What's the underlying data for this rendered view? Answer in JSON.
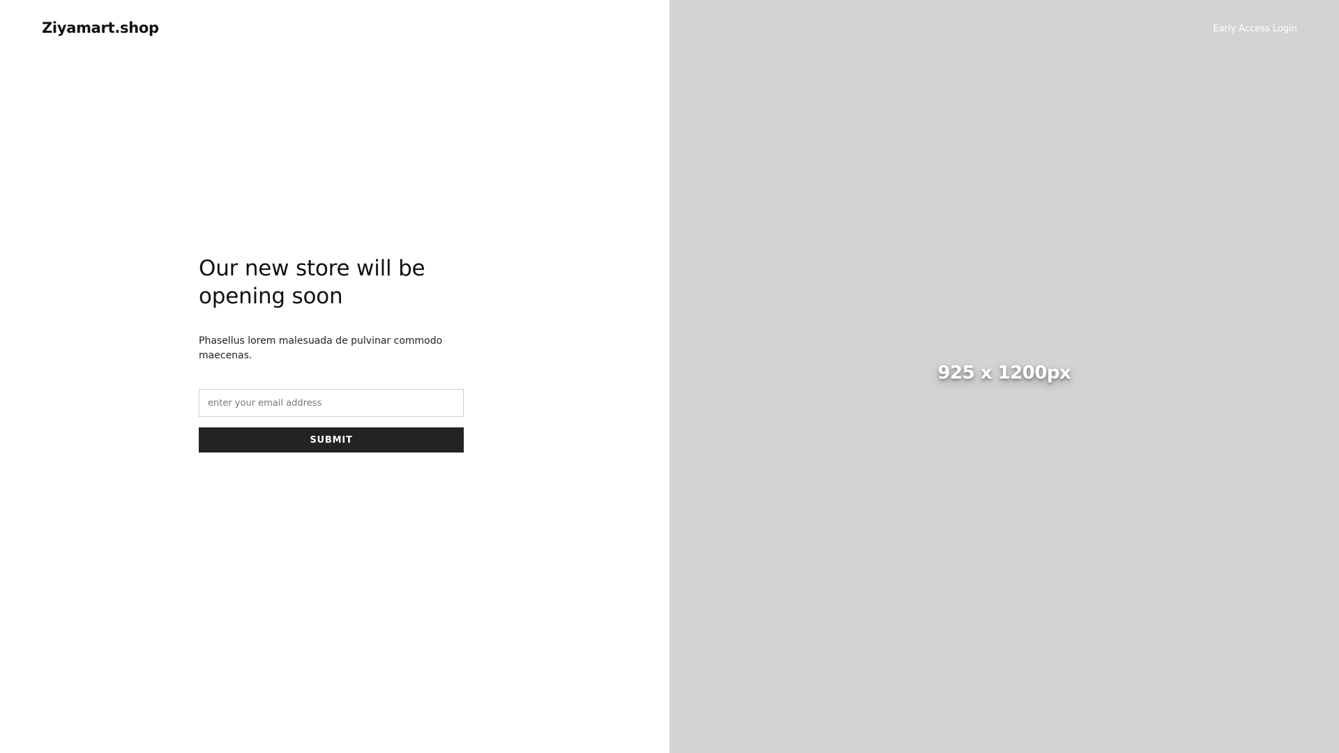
{
  "header": {
    "logo_text": "Ziyamart.shop",
    "early_access_label": "Early Access Login"
  },
  "main": {
    "headline_line1": "Our new store will be",
    "headline_line2": "opening soon",
    "description": "Phasellus lorem malesuada de pulvinar commodo maecenas.",
    "email_placeholder": "enter your email address",
    "email_value": "",
    "submit_label": "SUBMIT"
  },
  "image_panel": {
    "placeholder_label": "925 x 1200px"
  },
  "colors": {
    "button_background": "#232323",
    "image_panel_background": "#d3d3d3",
    "page_background": "#ffffff"
  }
}
